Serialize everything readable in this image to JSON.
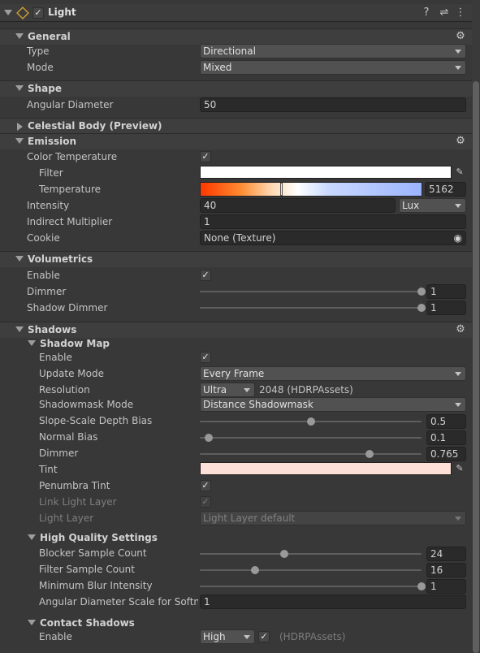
{
  "component": {
    "title": "Light",
    "enabled": true
  },
  "sections": {
    "general": "General",
    "shape": "Shape",
    "celestial": "Celestial Body (Preview)",
    "emission": "Emission",
    "volumetrics": "Volumetrics",
    "shadows": "Shadows",
    "shadow_map": "Shadow Map",
    "high_quality": "High Quality Settings",
    "contact": "Contact Shadows"
  },
  "general": {
    "type_label": "Type",
    "type_value": "Directional",
    "mode_label": "Mode",
    "mode_value": "Mixed"
  },
  "shape": {
    "angular_label": "Angular Diameter",
    "angular_value": "50"
  },
  "emission": {
    "color_temp_label": "Color Temperature",
    "filter_label": "Filter",
    "filter_color": "#ffffff",
    "temperature_label": "Temperature",
    "temperature_value": "5162",
    "intensity_label": "Intensity",
    "intensity_value": "40",
    "intensity_unit": "Lux",
    "indirect_label": "Indirect Multiplier",
    "indirect_value": "1",
    "cookie_label": "Cookie",
    "cookie_value": "None (Texture)"
  },
  "volumetrics": {
    "enable_label": "Enable",
    "dimmer_label": "Dimmer",
    "dimmer_value": "1",
    "dimmer_fraction": 1.0,
    "shadow_dimmer_label": "Shadow Dimmer",
    "shadow_dimmer_value": "1",
    "shadow_dimmer_fraction": 1.0
  },
  "shadow_map": {
    "enable_label": "Enable",
    "update_label": "Update Mode",
    "update_value": "Every Frame",
    "resolution_label": "Resolution",
    "resolution_value": "Ultra",
    "resolution_note": "2048 (HDRPAssets)",
    "shadowmask_label": "Shadowmask Mode",
    "shadowmask_value": "Distance Shadowmask",
    "slope_label": "Slope-Scale Depth Bias",
    "slope_value": "0.5",
    "slope_fraction": 0.5,
    "normal_label": "Normal Bias",
    "normal_value": "0.1",
    "normal_fraction": 0.04,
    "dimmer_label": "Dimmer",
    "dimmer_value": "0.765",
    "dimmer_fraction": 0.765,
    "tint_label": "Tint",
    "tint_color": "#fde0d8",
    "penumbra_label": "Penumbra Tint",
    "link_label": "Link Light Layer",
    "light_layer_label": "Light Layer",
    "light_layer_value": "Light Layer default"
  },
  "high_quality": {
    "blocker_label": "Blocker Sample Count",
    "blocker_value": "24",
    "blocker_fraction": 0.38,
    "filter_label": "Filter Sample Count",
    "filter_value": "16",
    "filter_fraction": 0.25,
    "blur_label": "Minimum Blur Intensity",
    "blur_value": "1",
    "blur_fraction": 1.0,
    "angular_scale_label": "Angular Diameter Scale for Softnes",
    "angular_scale_value": "1"
  },
  "contact": {
    "enable_label": "Enable",
    "quality_value": "High",
    "note": "(HDRPAssets)"
  },
  "icons": {
    "help": "?",
    "presets": "⇌",
    "menu": "⋮",
    "gear": "⚙",
    "picker": "✎",
    "object_picker": "◉",
    "check": "✓"
  }
}
